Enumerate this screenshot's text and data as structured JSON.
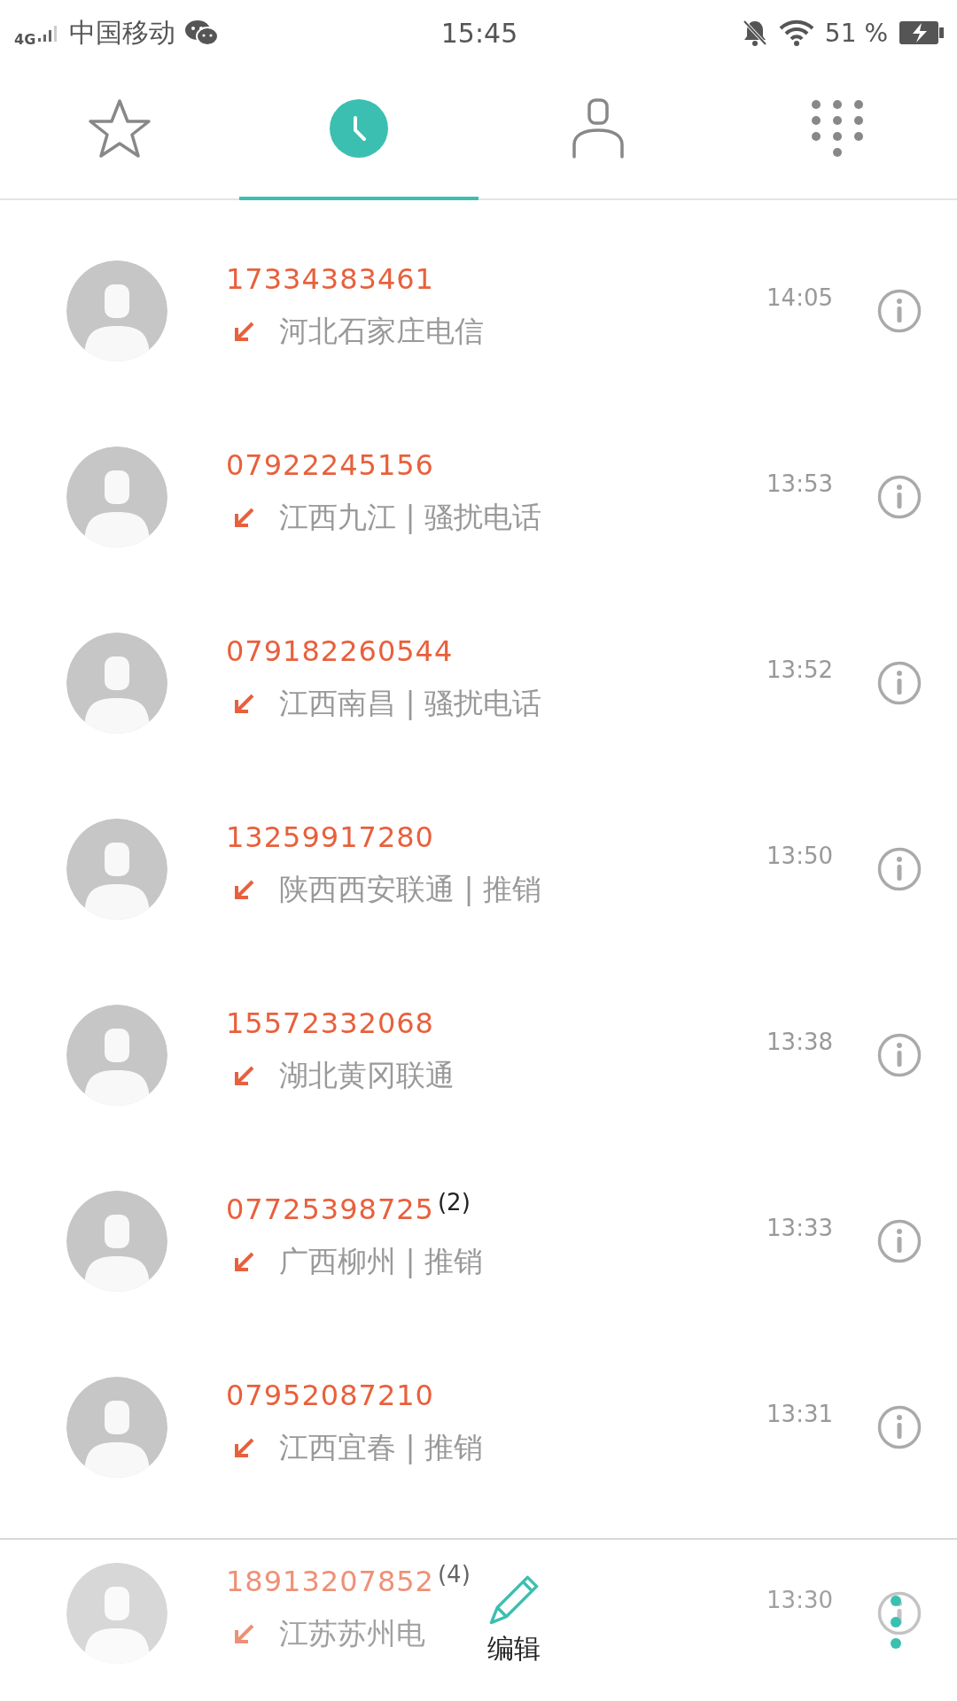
{
  "status_bar": {
    "network": "4G",
    "carrier": "中国移动",
    "time": "15:45",
    "battery": "51 %"
  },
  "tabs": [
    {
      "kind": "favorites",
      "selected": false
    },
    {
      "kind": "recents",
      "selected": true
    },
    {
      "kind": "contacts",
      "selected": false
    },
    {
      "kind": "dialpad",
      "selected": false
    }
  ],
  "calls": [
    {
      "number": "17334383461",
      "location": "河北石家庄电信",
      "time": "14:05",
      "kind": "incoming",
      "missed": true
    },
    {
      "number": "07922245156",
      "location": "江西九江 | 骚扰电话",
      "time": "13:53",
      "kind": "incoming",
      "missed": true
    },
    {
      "number": "079182260544",
      "location": "江西南昌 | 骚扰电话",
      "time": "13:52",
      "kind": "incoming",
      "missed": true
    },
    {
      "number": "13259917280",
      "location": "陕西西安联通 | 推销",
      "time": "13:50",
      "kind": "incoming",
      "missed": true
    },
    {
      "number": "15572332068",
      "location": "湖北黄冈联通",
      "time": "13:38",
      "kind": "incoming",
      "missed": true
    },
    {
      "number": "07725398725",
      "count": "(2)",
      "location": "广西柳州 | 推销",
      "time": "13:33",
      "kind": "incoming",
      "missed": true
    },
    {
      "number": "07952087210",
      "location": "江西宜春 | 推销",
      "time": "13:31",
      "kind": "incoming",
      "missed": true
    },
    {
      "number": "18913207852",
      "count": "(4)",
      "location": "江苏苏州电",
      "time": "13:30",
      "kind": "incoming",
      "missed": true
    }
  ],
  "bottom_bar": {
    "edit_label": "编辑"
  }
}
